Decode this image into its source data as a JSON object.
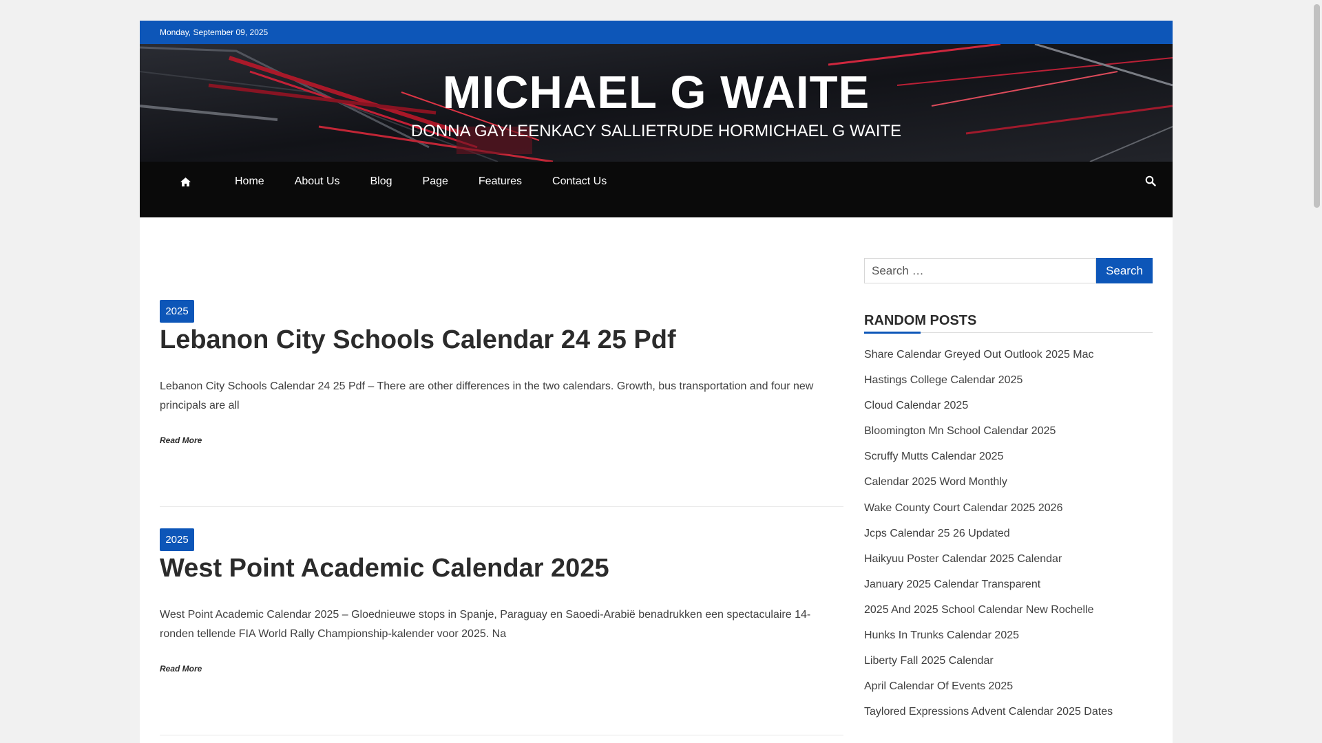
{
  "topbar": {
    "date": "Monday, September 09, 2025"
  },
  "header": {
    "title": "MICHAEL G WAITE",
    "tagline": "DONNA GAYLEENKACY SALLIETRUDE HORMICHAEL G WAITE"
  },
  "nav": {
    "home_icon": "home-icon",
    "items": [
      {
        "label": "Home"
      },
      {
        "label": "About Us"
      },
      {
        "label": "Blog"
      },
      {
        "label": "Page"
      },
      {
        "label": "Features"
      },
      {
        "label": "Contact Us"
      }
    ],
    "search_icon": "search-icon"
  },
  "posts": [
    {
      "category": "2025",
      "title": "Lebanon City Schools Calendar 24 25 Pdf",
      "excerpt": "Lebanon City Schools Calendar 24 25 Pdf – There are other differences in the two calendars. Growth, bus transportation and four new principals are all",
      "read_more": "Read More"
    },
    {
      "category": "2025",
      "title": "West Point Academic Calendar 2025",
      "excerpt": "West Point Academic Calendar 2025 – Gloednieuwe stops in Spanje, Paraguay en Saoedi-Arabië benadrukken een spectaculaire 14-ronden tellende FIA World Rally Championship-kalender voor 2025. Na",
      "read_more": "Read More"
    }
  ],
  "sidebar": {
    "search": {
      "placeholder": "Search …",
      "button": "Search"
    },
    "random_posts": {
      "title": "RANDOM POSTS",
      "items": [
        "Share Calendar Greyed Out Outlook 2025 Mac",
        "Hastings College Calendar 2025",
        "Cloud Calendar 2025",
        "Bloomington Mn School Calendar 2025",
        "Scruffy Mutts Calendar 2025",
        "Calendar 2025 Word Monthly",
        "Wake County Court Calendar 2025 2026",
        "Jcps Calendar 25 26 Updated",
        "Haikyuu Poster Calendar 2025 Calendar",
        "January 2025 Calendar Transparent",
        "2025 And 2025 School Calendar New Rochelle",
        "Hunks In Trunks Calendar 2025",
        "Liberty Fall 2025 Calendar",
        "April Calendar Of Events 2025",
        "Taylored Expressions Advent Calendar 2025 Dates"
      ]
    }
  },
  "colors": {
    "accent": "#0d56b8",
    "nav_bg": "#0a0a0a",
    "page_bg": "#f1f1f1"
  }
}
